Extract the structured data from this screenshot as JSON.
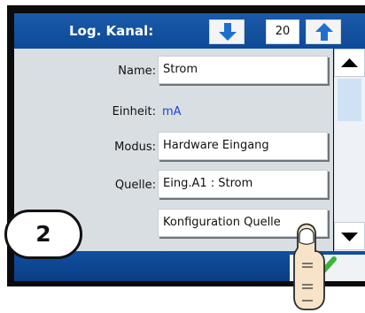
{
  "header": {
    "title": "Log. Kanal:",
    "channel_value": "20"
  },
  "fields": {
    "name": {
      "label": "Name:",
      "value": "Strom"
    },
    "einheit": {
      "label": "Einheit:",
      "value": "mA"
    },
    "modus": {
      "label": "Modus:",
      "value": "Hardware Eingang"
    },
    "quelle": {
      "label": "Quelle:",
      "value": "Eing.A1 : Strom"
    },
    "config_button": "Konfiguration Quelle"
  },
  "step_badge": "2",
  "icons": {
    "prev": "arrow-down-icon",
    "next": "arrow-up-icon",
    "scroll_up": "triangle-up-icon",
    "scroll_down": "triangle-down-icon",
    "confirm": "checkmark-icon",
    "pointer": "finger-pointer-icon"
  },
  "colors": {
    "header_blue": "#0d4a97",
    "panel_gray": "#d9dee3",
    "unit_blue": "#1b45d6",
    "check_green": "#3cb43c"
  }
}
